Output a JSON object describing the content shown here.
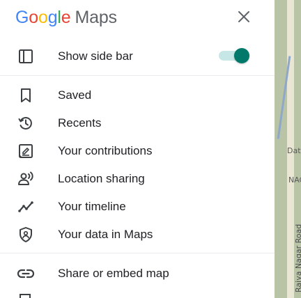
{
  "header": {
    "logo_google": [
      "G",
      "o",
      "o",
      "g",
      "l",
      "e"
    ],
    "logo_maps": "Maps",
    "close_icon": "close-icon"
  },
  "toggle_row": {
    "label": "Show side bar",
    "icon": "sidebar-icon",
    "toggle_on": true,
    "accent": "#00796b"
  },
  "menu_items": [
    {
      "label": "Saved",
      "icon": "bookmark-icon"
    },
    {
      "label": "Recents",
      "icon": "history-icon"
    },
    {
      "label": "Your contributions",
      "icon": "contributions-icon"
    },
    {
      "label": "Location sharing",
      "icon": "location-sharing-icon"
    },
    {
      "label": "Your timeline",
      "icon": "timeline-icon"
    },
    {
      "label": "Your data in Maps",
      "icon": "shield-icon"
    }
  ],
  "share_item": {
    "label": "Share or embed map",
    "icon": "link-icon"
  },
  "map_background": {
    "text_dat": "Dat",
    "text_nag": "NAGA",
    "text_vertical": "Rajya Nagar Road"
  }
}
